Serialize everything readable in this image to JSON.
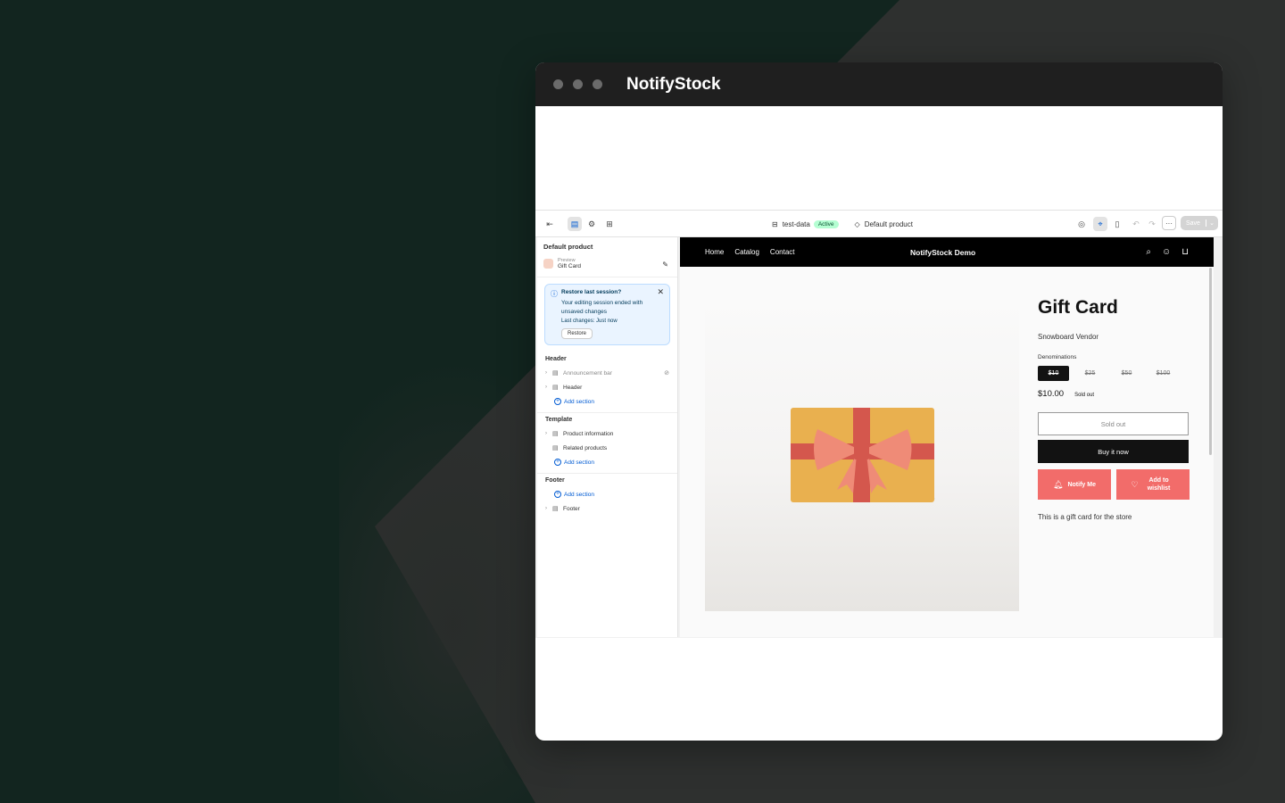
{
  "window": {
    "title": "NotifyStock"
  },
  "toolbar": {
    "theme_name": "test-data",
    "theme_status": "Active",
    "template_name": "Default product",
    "save_label": "Save",
    "more_label": "···"
  },
  "sidebar": {
    "title": "Default product",
    "preview_label": "Preview",
    "preview_value": "Gift Card",
    "restore": {
      "title": "Restore last session?",
      "body": "Your editing session ended with unsaved changes",
      "last_changes": "Last changes: Just now",
      "button": "Restore"
    },
    "groups": [
      {
        "title": "Header",
        "items": [
          "Announcement bar",
          "Header"
        ],
        "add": "Add section"
      },
      {
        "title": "Template",
        "items": [
          "Product information",
          "Related products"
        ],
        "add": "Add section"
      },
      {
        "title": "Footer",
        "items": [
          "Footer"
        ],
        "add": "Add section"
      }
    ]
  },
  "store": {
    "nav": [
      "Home",
      "Catalog",
      "Contact"
    ],
    "name": "NotifyStock Demo",
    "product": {
      "title": "Gift Card",
      "vendor": "Snowboard Vendor",
      "denominations_label": "Denominations",
      "denominations": [
        "$10",
        "$25",
        "$50",
        "$100"
      ],
      "price": "$10.00",
      "sold_out_tag": "Sold out",
      "sold_out_button": "Sold out",
      "buy_button": "Buy it now",
      "notify_button": "Notify Me",
      "wishlist_button": "Add to wishlist",
      "description": "This is a gift card for the store"
    }
  },
  "colors": {
    "accent_red": "#f26c6a",
    "active_badge": "#b4fed2",
    "info_blue": "#005bd3"
  }
}
